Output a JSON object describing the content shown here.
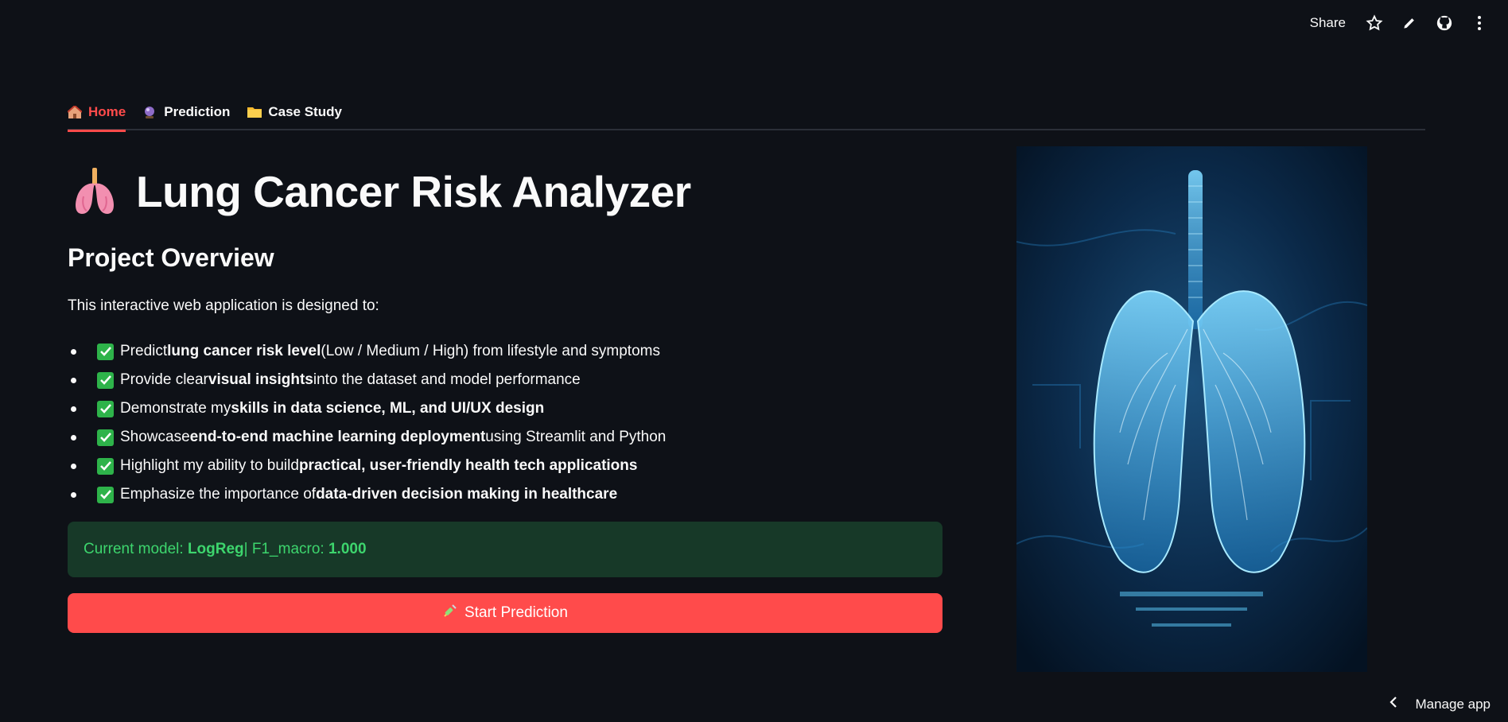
{
  "toolbar": {
    "share_label": "Share",
    "icons": [
      "star-icon",
      "pencil-icon",
      "github-icon",
      "more-vertical-icon"
    ]
  },
  "tabs": [
    {
      "label": "Home",
      "icon": "house-icon",
      "active": true
    },
    {
      "label": "Prediction",
      "icon": "crystal-ball-icon",
      "active": false
    },
    {
      "label": "Case Study",
      "icon": "folder-icon",
      "active": false
    }
  ],
  "page": {
    "title": "Lung Cancer Risk Analyzer",
    "title_icon": "lungs-icon",
    "subtitle": "Project Overview",
    "intro": "This interactive web application is designed to:"
  },
  "bullets": [
    {
      "pre": "Predict ",
      "bold": "lung cancer risk level",
      "post": " (Low / Medium / High) from lifestyle and symptoms"
    },
    {
      "pre": "Provide clear ",
      "bold": "visual insights",
      "post": " into the dataset and model performance"
    },
    {
      "pre": "Demonstrate my ",
      "bold": "skills in data science, ML, and UI/UX design",
      "post": ""
    },
    {
      "pre": "Showcase ",
      "bold": "end-to-end machine learning deployment",
      "post": " using Streamlit and Python"
    },
    {
      "pre": "Highlight my ability to build ",
      "bold": "practical, user-friendly health tech applications",
      "post": ""
    },
    {
      "pre": "Emphasize the importance of ",
      "bold": "data-driven decision making in healthcare",
      "post": ""
    }
  ],
  "model": {
    "prefix": "Current model: ",
    "name": "LogReg",
    "sep": " | F1_macro: ",
    "score": "1.000"
  },
  "start_button": {
    "label": "Start Prediction",
    "icon": "syringe-icon"
  },
  "manage": {
    "label": "Manage app",
    "icon": "chevron-left-icon"
  },
  "colors": {
    "background": "#0e1117",
    "accent": "#ff4b4b",
    "success_bg": "#173928",
    "success_text": "#3dd56d",
    "check_green": "#2eb34a"
  }
}
